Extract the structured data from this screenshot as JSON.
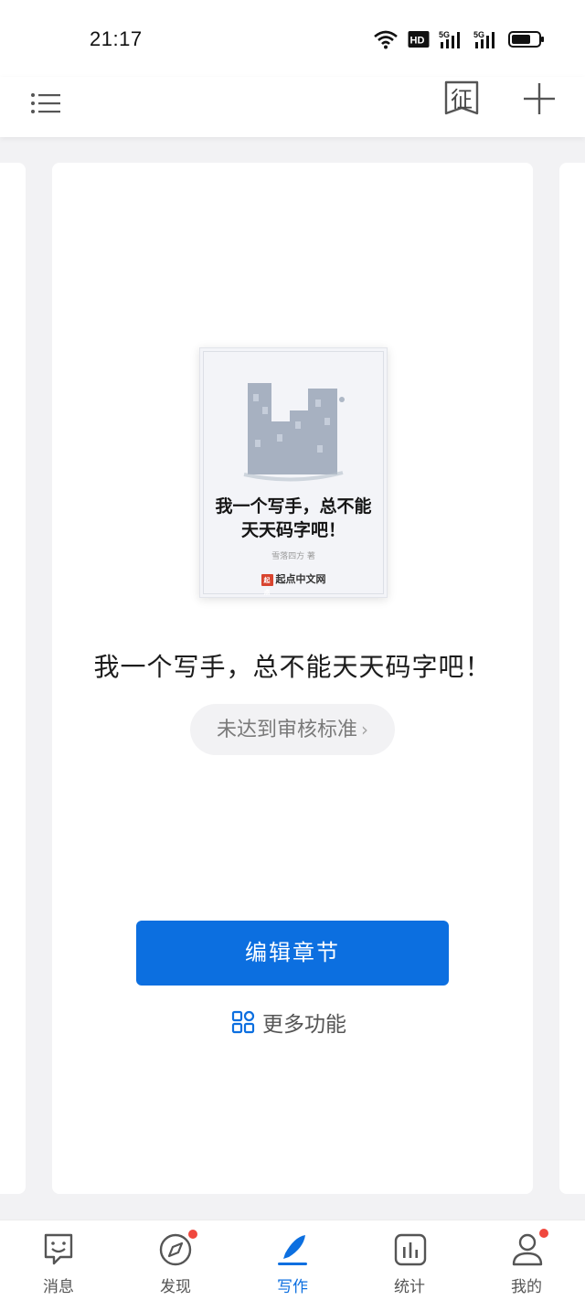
{
  "status_bar": {
    "time": "21:17",
    "icons": [
      "wifi-icon",
      "hd-icon",
      "5g-signal-icon",
      "5g-signal-icon",
      "battery-icon"
    ]
  },
  "top_bar": {
    "menu_icon": "list-icon",
    "zheng_label": "征",
    "add_icon": "plus-icon"
  },
  "book": {
    "cover_title": "我一个写手，总不能天天码字吧！",
    "cover_author": "雪落四方 著",
    "cover_brand": "起点中文网",
    "cover_seal": "起点",
    "title": "我一个写手，总不能天天码字吧！",
    "status_label": "未达到审核标准",
    "status_chevron": "›"
  },
  "actions": {
    "edit_label": "编辑章节",
    "more_label": "更多功能",
    "accent_color": "#0c6fe0"
  },
  "tab_bar": {
    "items": [
      {
        "label": "消息",
        "icon": "message-smile-icon",
        "active": false,
        "badge": false
      },
      {
        "label": "发现",
        "icon": "compass-icon",
        "active": false,
        "badge": true
      },
      {
        "label": "写作",
        "icon": "quill-pen-icon",
        "active": true,
        "badge": false
      },
      {
        "label": "统计",
        "icon": "bar-chart-icon",
        "active": false,
        "badge": false
      },
      {
        "label": "我的",
        "icon": "user-icon",
        "active": false,
        "badge": true
      }
    ]
  }
}
